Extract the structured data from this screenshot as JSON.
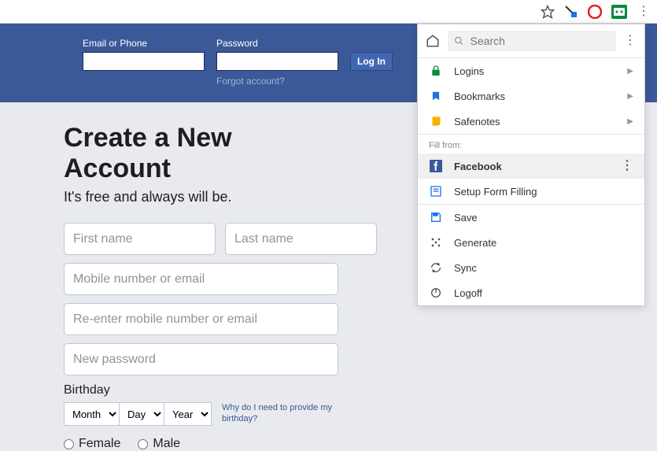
{
  "header": {
    "email_label": "Email or Phone",
    "password_label": "Password",
    "login_label": "Log In",
    "forgot_label": "Forgot account?"
  },
  "signup": {
    "title": "Create a New Account",
    "tagline": "It's free and always will be.",
    "first_name_ph": "First name",
    "last_name_ph": "Last name",
    "mobile_ph": "Mobile number or email",
    "reenter_ph": "Re-enter mobile number or email",
    "password_ph": "New password",
    "birthday_label": "Birthday",
    "month": "Month",
    "day": "Day",
    "year": "Year",
    "why_link": "Why do I need to provide my birthday?",
    "female": "Female",
    "male": "Male"
  },
  "popup": {
    "search_ph": "Search",
    "logins": "Logins",
    "bookmarks": "Bookmarks",
    "safenotes": "Safenotes",
    "fill_from": "Fill from:",
    "facebook": "Facebook",
    "setup_form": "Setup Form Filling",
    "save": "Save",
    "generate": "Generate",
    "sync": "Sync",
    "logoff": "Logoff"
  }
}
